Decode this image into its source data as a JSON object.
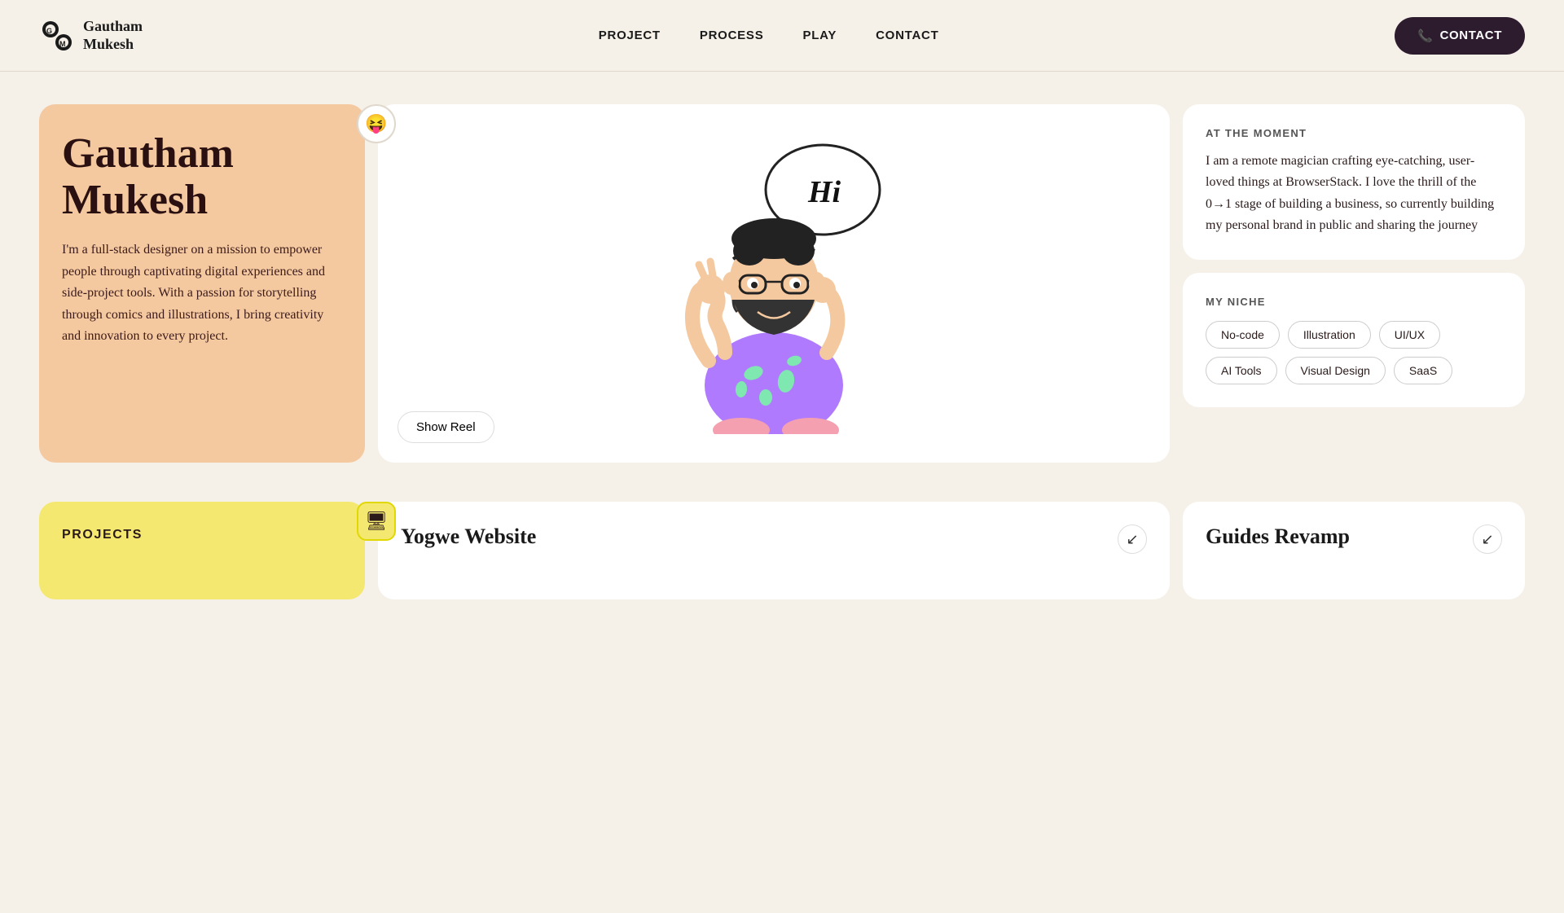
{
  "nav": {
    "logo_name": "Gautham\nMukesh",
    "links": [
      {
        "id": "project",
        "label": "PROJECT"
      },
      {
        "id": "process",
        "label": "PROCESS"
      },
      {
        "id": "play",
        "label": "PLAY"
      },
      {
        "id": "contact",
        "label": "CONTACT"
      }
    ],
    "contact_btn": "CONTACT",
    "contact_icon": "📞"
  },
  "hero": {
    "emoji_badge": "😝",
    "intro": {
      "name": "Gautham Mukesh",
      "bio": "I'm a full-stack designer on a mission to empower people through captivating digital experiences and side-project tools. With a passion for storytelling through comics and illustrations, I bring creativity and innovation to every project."
    },
    "show_reel": "Show Reel",
    "at_moment": {
      "heading": "AT THE MOMENT",
      "text": "I am a remote magician crafting eye-catching, user-loved things at BrowserStack. I love the thrill of the 0→1 stage of building a business, so currently building my personal brand in public and sharing the journey"
    },
    "niche": {
      "heading": "MY NICHE",
      "tags": [
        "No-code",
        "Illustration",
        "UI/UX",
        "AI Tools",
        "Visual Design",
        "SaaS"
      ]
    }
  },
  "projects": {
    "label": "PROJECTS",
    "monitor_badge": "🖥",
    "items": [
      {
        "name": "Yogwe Website",
        "arrow": "↙"
      },
      {
        "name": "Guides Revamp",
        "arrow": "↙"
      }
    ]
  }
}
